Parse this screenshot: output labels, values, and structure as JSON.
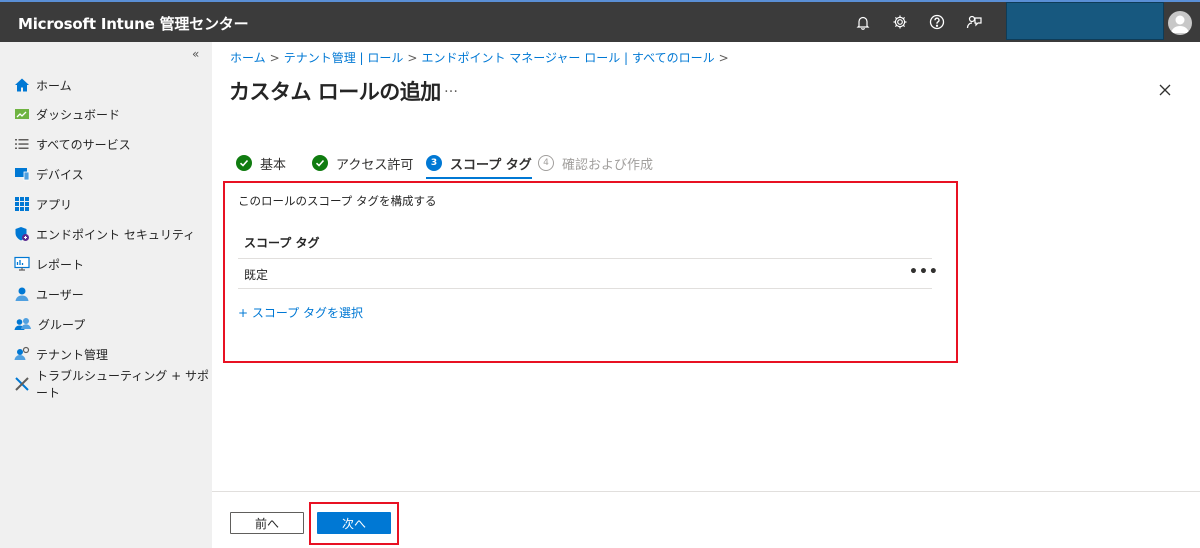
{
  "app": {
    "title": "Microsoft Intune 管理センター"
  },
  "topbar": {
    "icons": [
      "bell-icon",
      "gear-icon",
      "help-icon",
      "feedback-icon"
    ]
  },
  "sidebar": {
    "collapse_glyph": "«",
    "items": [
      {
        "label": "ホーム",
        "icon": "home-icon"
      },
      {
        "label": "ダッシュボード",
        "icon": "dashboard-icon"
      },
      {
        "label": "すべてのサービス",
        "icon": "list-icon"
      },
      {
        "label": "デバイス",
        "icon": "device-icon"
      },
      {
        "label": "アプリ",
        "icon": "apps-icon"
      },
      {
        "label": "エンドポイント セキュリティ",
        "icon": "shield-icon"
      },
      {
        "label": "レポート",
        "icon": "report-icon"
      },
      {
        "label": "ユーザー",
        "icon": "user-icon"
      },
      {
        "label": "グループ",
        "icon": "group-icon"
      },
      {
        "label": "テナント管理",
        "icon": "tenant-icon"
      },
      {
        "label": "トラブルシューティング + サポート",
        "icon": "tools-icon"
      }
    ]
  },
  "breadcrumb": {
    "items": [
      "ホーム",
      "テナント管理 | ロール",
      "エンドポイント マネージャー ロール | すべてのロール"
    ],
    "separator": ">"
  },
  "page": {
    "title": "カスタム ロールの追加",
    "more": "…"
  },
  "steps": [
    {
      "number": "1",
      "label": "基本",
      "state": "done"
    },
    {
      "number": "2",
      "label": "アクセス許可",
      "state": "done"
    },
    {
      "number": "3",
      "label": "スコープ タグ",
      "state": "current"
    },
    {
      "number": "4",
      "label": "確認および作成",
      "state": "todo"
    }
  ],
  "content": {
    "description": "このロールのスコープ タグを構成する",
    "table": {
      "header": "スコープ タグ",
      "rows": [
        "既定"
      ],
      "more": "•••"
    },
    "select_link": "+ スコープ タグを選択"
  },
  "footer": {
    "prev_label": "前へ",
    "next_label": "次へ"
  },
  "colors": {
    "accent": "#0078d4",
    "topbar": "#3b3b3b",
    "success": "#107c10",
    "highlight": "#e81123"
  }
}
